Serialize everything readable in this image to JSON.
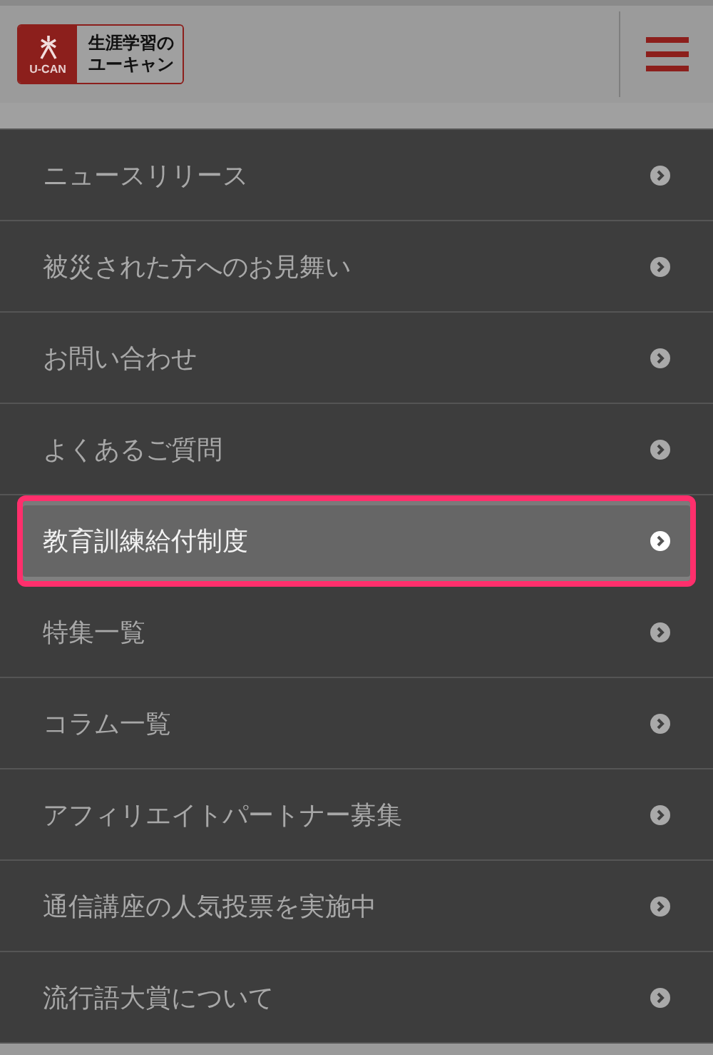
{
  "header": {
    "logo": {
      "mark_text": "U-CAN",
      "lines": [
        "生涯学習の",
        "ユーキャン"
      ]
    }
  },
  "menu": [
    {
      "label": "ニュースリリース",
      "selected": false
    },
    {
      "label": "被災された方へのお見舞い",
      "selected": false
    },
    {
      "label": "お問い合わせ",
      "selected": false
    },
    {
      "label": "よくあるご質問",
      "selected": false
    },
    {
      "label": "教育訓練給付制度",
      "selected": true
    },
    {
      "label": "特集一覧",
      "selected": false
    },
    {
      "label": "コラム一覧",
      "selected": false
    },
    {
      "label": "アフィリエイトパートナー募集",
      "selected": false
    },
    {
      "label": "通信講座の人気投票を実施中",
      "selected": false
    },
    {
      "label": "流行語大賞について",
      "selected": false
    }
  ]
}
